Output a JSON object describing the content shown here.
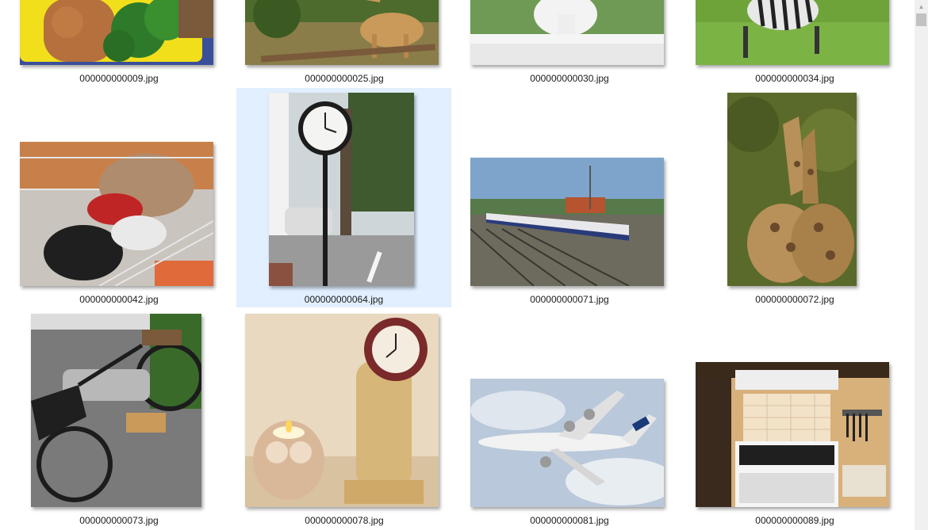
{
  "files": [
    {
      "name": "000000000009.jpg",
      "subject": "bento-lunch-box",
      "selected": false
    },
    {
      "name": "000000000025.jpg",
      "subject": "giraffe-eating",
      "selected": false
    },
    {
      "name": "000000000030.jpg",
      "subject": "white-vase-on-railing",
      "selected": false
    },
    {
      "name": "000000000034.jpg",
      "subject": "zebra-grazing",
      "selected": false
    },
    {
      "name": "000000000042.jpg",
      "subject": "shoes-in-wire-basket-with-dog",
      "selected": false
    },
    {
      "name": "000000000064.jpg",
      "subject": "street-clock",
      "selected": true
    },
    {
      "name": "000000000071.jpg",
      "subject": "train-on-tracks",
      "selected": false
    },
    {
      "name": "000000000072.jpg",
      "subject": "two-giraffes",
      "selected": false
    },
    {
      "name": "000000000073.jpg",
      "subject": "vintage-motorcycle",
      "selected": false
    },
    {
      "name": "000000000078.jpg",
      "subject": "owl-candle-and-mantel-clock",
      "selected": false
    },
    {
      "name": "000000000081.jpg",
      "subject": "air-france-airplane",
      "selected": false
    },
    {
      "name": "000000000089.jpg",
      "subject": "kitchen-stove",
      "selected": false
    }
  ],
  "theme": {
    "selection_background": "#e1efff",
    "caption_color": "#1a1a1a",
    "scrollbar_track": "#f0f0f0",
    "scrollbar_thumb": "#c2c2c2"
  },
  "scrollbar": {
    "up_icon": "triangle-up-icon"
  }
}
